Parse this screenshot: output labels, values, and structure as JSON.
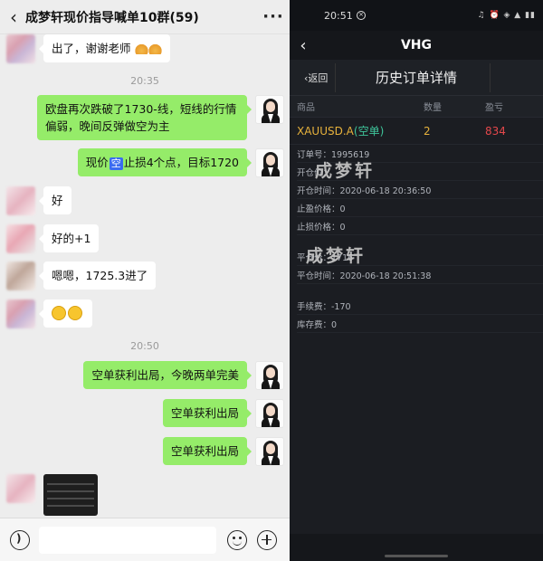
{
  "chat": {
    "title": "成梦轩现价指导喊单10群(59)",
    "messages": [
      {
        "side": "left",
        "text": "出了，谢谢老师"
      },
      {
        "type": "time",
        "text": "20:35"
      },
      {
        "side": "right",
        "text": "欧盘再次跌破了1730-线，短线的行情偏弱，晚间反弹做空为主"
      },
      {
        "side": "right",
        "pre": "现价",
        "tag": "空",
        "post": "止损4个点，目标1720"
      },
      {
        "side": "left",
        "text": "好"
      },
      {
        "side": "left",
        "text": "好的+1"
      },
      {
        "side": "left",
        "text": "嗯嗯，1725.3进了"
      },
      {
        "side": "left",
        "text": ""
      },
      {
        "type": "time",
        "text": "20:50"
      },
      {
        "side": "right",
        "text": "空单获利出局，今晚两单完美"
      },
      {
        "side": "right",
        "text": "空单获利出局"
      },
      {
        "side": "right",
        "text": "空单获利出局"
      }
    ],
    "input_placeholder": ""
  },
  "app": {
    "status_time": "20:51",
    "nav_title": "VHG",
    "back_label": "返回",
    "page_title": "历史订单详情",
    "columns": {
      "product": "商品",
      "qty": "数量",
      "pnl": "盈亏"
    },
    "order": {
      "symbol": "XAUUSD.A",
      "direction": "(空单)",
      "qty": "2",
      "pnl": "834"
    },
    "details": {
      "order_no": "订单号：1995619",
      "open_price": "开仓价：",
      "open_time": "开仓时间：2020-06-18 20:36:50",
      "tp": "止盈价格：0",
      "sl": "止损价格：0",
      "close_price": "平仓价：1716",
      "close_time": "平仓时间：2020-06-18 20:51:38",
      "fee": "手续费：-170",
      "storage": "库存费：0"
    },
    "watermark": "成梦轩"
  }
}
